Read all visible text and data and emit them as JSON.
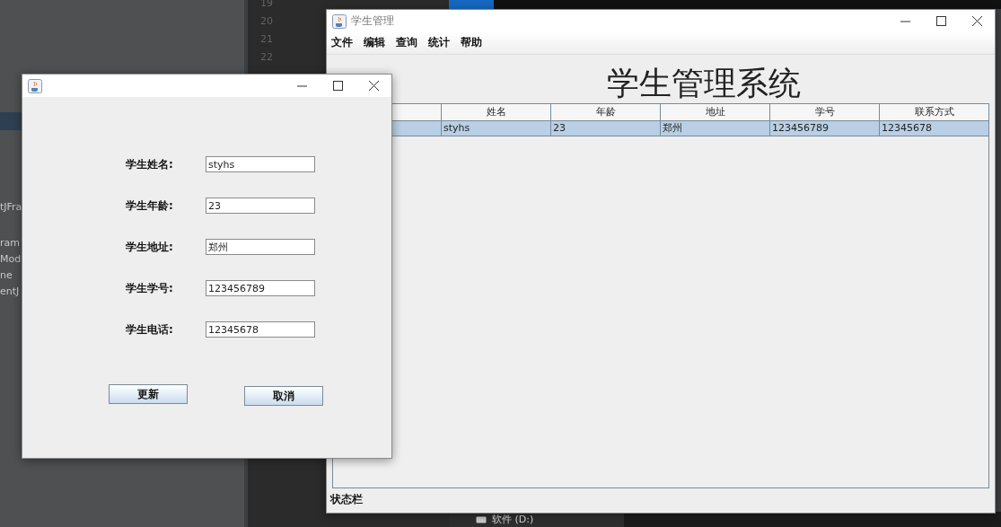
{
  "background": {
    "line_numbers": [
      "19",
      "20",
      "21",
      "22"
    ],
    "sidebar_fragments": [
      "tJFra",
      "ram",
      "Mod",
      "ne",
      "entJ"
    ],
    "drive_label": "软件 (D:)"
  },
  "main_window": {
    "title": "学生管理",
    "menu": [
      "文件",
      "编辑",
      "查询",
      "统计",
      "帮助"
    ],
    "heading": "学生管理系统",
    "table": {
      "columns": [
        "姓名",
        "年龄",
        "地址",
        "学号",
        "联系方式"
      ],
      "rows": [
        {
          "cells": [
            "styhs",
            "23",
            "郑州",
            "123456789",
            "12345678"
          ],
          "selected": true
        }
      ]
    },
    "status_bar": "状态栏"
  },
  "dialog": {
    "fields": [
      {
        "label": "学生姓名:",
        "value": "styhs"
      },
      {
        "label": "学生年龄:",
        "value": "23"
      },
      {
        "label": "学生地址:",
        "value": "郑州"
      },
      {
        "label": "学生学号:",
        "value": "123456789"
      },
      {
        "label": "学生电话:",
        "value": "12345678"
      }
    ],
    "buttons": [
      "更新",
      "取消"
    ]
  }
}
